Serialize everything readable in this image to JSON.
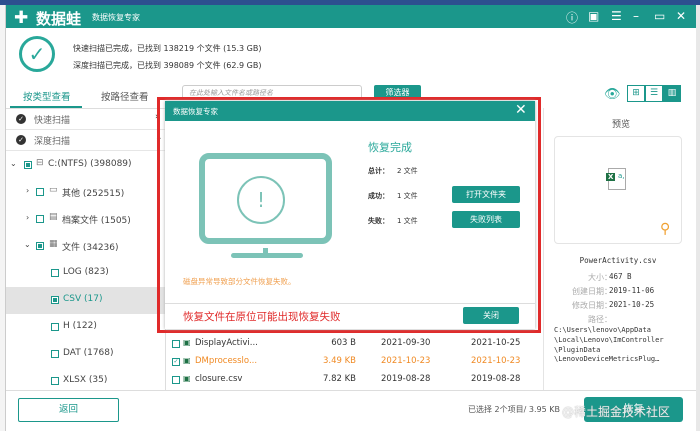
{
  "app": {
    "logo": "数据蛙",
    "subtitle": "数据恢复专家"
  },
  "summary": {
    "quick": "快速扫描已完成，已找到 138219 个文件 (15.3 GB)",
    "deep": "深度扫描已完成，已找到 398089 个文件 (62.9 GB)"
  },
  "tabs": [
    {
      "label": "按类型查看",
      "active": true
    },
    {
      "label": "按路径查看",
      "active": false
    }
  ],
  "scans": [
    {
      "label": "快速扫描"
    },
    {
      "label": "深度扫描"
    }
  ],
  "tree": [
    {
      "label": "C:(NTFS) (398089)",
      "checked": "partial",
      "expanded": true
    },
    {
      "label": "其他 (252515)",
      "checked": false
    },
    {
      "label": "档案文件 (1505)",
      "checked": false
    },
    {
      "label": "文件 (34236)",
      "checked": "partial",
      "expanded": true
    },
    {
      "label": "LOG (823)",
      "checked": false
    },
    {
      "label": "CSV (17)",
      "checked": "partial",
      "selected": true
    },
    {
      "label": "H (122)",
      "checked": false
    },
    {
      "label": "DAT (1768)",
      "checked": false
    },
    {
      "label": "XLSX (35)",
      "checked": false
    }
  ],
  "toolbar": {
    "search_placeholder": "在此处输入文件名或路径名",
    "filter": "筛选器"
  },
  "files": [
    {
      "name": "DisplayActivi...",
      "size": "603  B",
      "created": "2021-09-30",
      "modified": "2021-10-25",
      "checked": false
    },
    {
      "name": "DMprocesslo...",
      "size": "3.49 KB",
      "created": "2021-10-23",
      "modified": "2021-10-23",
      "checked": true
    },
    {
      "name": "closure.csv",
      "size": "7.82 KB",
      "created": "2019-08-28",
      "modified": "2019-08-28",
      "checked": false
    }
  ],
  "preview": {
    "title": "预览",
    "filename": "PowerActivity.csv",
    "size_label": "大小：",
    "size": "467  B",
    "created_label": "创建日期：",
    "created": "2019-11-06",
    "modified_label": "修改日期：",
    "modified": "2021-10-25",
    "path_label": "路径：",
    "path": [
      "C:\\Users\\lenovo\\AppData",
      "\\Local\\Lenovo\\ImController",
      "\\PluginData",
      "\\LenovoDeviceMetricsPlug…"
    ]
  },
  "bottom": {
    "back": "返回",
    "selection": "已选择 2个项目/ 3.95 KB",
    "recover": "恢复",
    "watermark": "@稀土掘金技术社区"
  },
  "modal": {
    "title": "数据恢复专家",
    "heading": "恢复完成",
    "total_label": "总计：",
    "total": "2 文件",
    "success_label": "成功：",
    "success": "1 文件",
    "fail_label": "失败：",
    "fail": "1 文件",
    "open_folder": "打开文件夹",
    "fail_list": "失败列表",
    "warning": "磁盘异常导致部分文件恢复失败。",
    "note": "恢复文件在原位可能出现恢复失败",
    "close": "关闭"
  },
  "colors": {
    "accent": "#1b978b",
    "warning": "#f0a050",
    "annotation": "#e02a2a"
  }
}
